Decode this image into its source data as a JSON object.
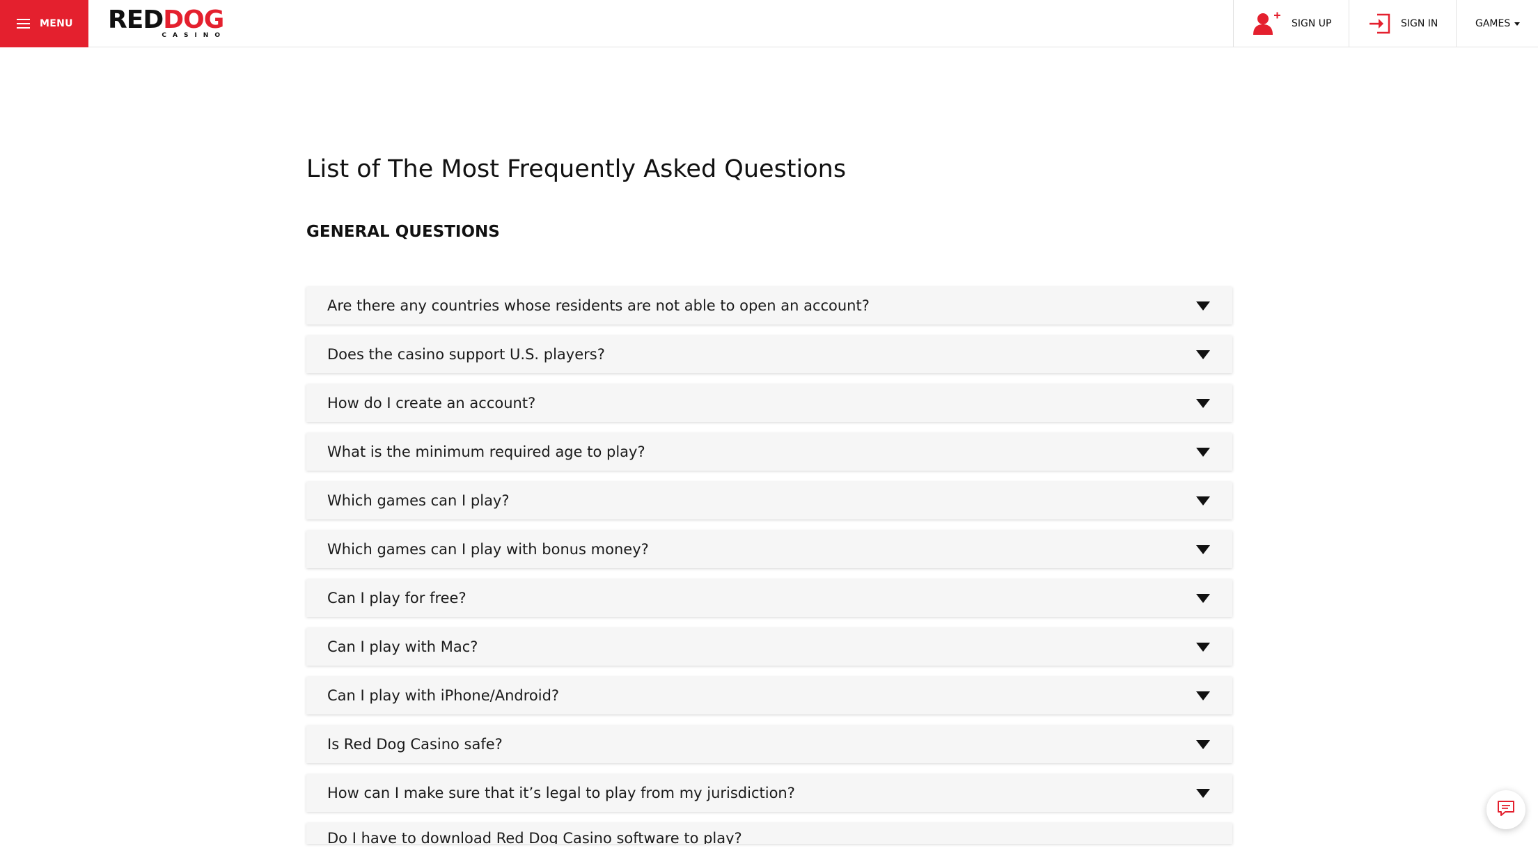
{
  "header": {
    "menu_label": "MENU",
    "logo": {
      "name_left": "RED",
      "name_right": "DOG",
      "sub": "CASINO"
    },
    "signup_label": "SIGN UP",
    "signin_label": "SIGN IN",
    "games_label": "GAMES",
    "brand_color": "#e4202e"
  },
  "main": {
    "title": "List of The Most Frequently Asked Questions",
    "section_title": "GENERAL QUESTIONS",
    "questions": [
      "Are there any countries whose residents are not able to open an account?",
      "Does the casino support U.S. players?",
      "How do I create an account?",
      "What is the minimum required age to play?",
      "Which games can I play?",
      "Which games can I play with bonus money?",
      "Can I play for free?",
      "Can I play with Mac?",
      "Can I play with iPhone/Android?",
      "Is Red Dog Casino safe?",
      "How can I make sure that it’s legal to play from my jurisdiction?",
      "Do I have to download Red Dog Casino software to play?"
    ]
  },
  "icons": {
    "menu": "hamburger-icon",
    "signup": "user-plus-icon",
    "signin": "sign-in-icon",
    "games": "caret-down-icon",
    "faq_toggle": "triangle-down-icon",
    "chat": "chat-icon"
  }
}
